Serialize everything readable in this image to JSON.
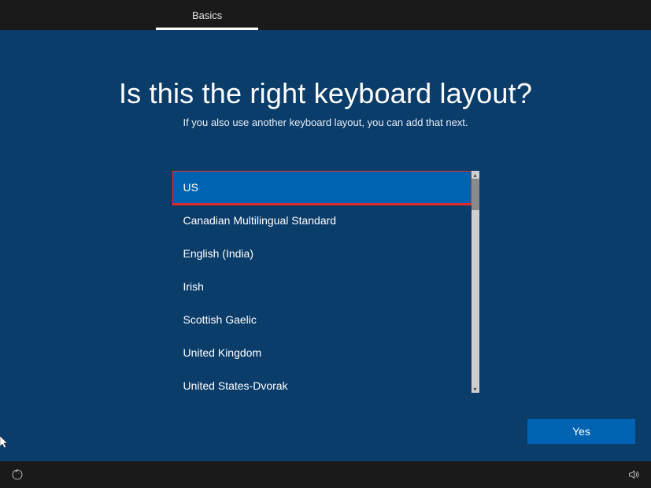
{
  "header": {
    "tab_label": "Basics"
  },
  "page": {
    "title": "Is this the right keyboard layout?",
    "subtitle": "If you also use another keyboard layout, you can add that next."
  },
  "keyboard_layouts": {
    "items": [
      {
        "label": "US",
        "selected": true,
        "highlighted": true
      },
      {
        "label": "Canadian Multilingual Standard",
        "selected": false
      },
      {
        "label": "English (India)",
        "selected": false
      },
      {
        "label": "Irish",
        "selected": false
      },
      {
        "label": "Scottish Gaelic",
        "selected": false
      },
      {
        "label": "United Kingdom",
        "selected": false
      },
      {
        "label": "United States-Dvorak",
        "selected": false
      }
    ]
  },
  "actions": {
    "yes_label": "Yes"
  },
  "icons": {
    "access": "accessibility-icon",
    "volume": "volume-icon"
  },
  "colors": {
    "bg": "#0b3d6b",
    "topbar": "#1a1a1a",
    "accent": "#0063b1",
    "highlight_outline": "#e22a2a"
  }
}
